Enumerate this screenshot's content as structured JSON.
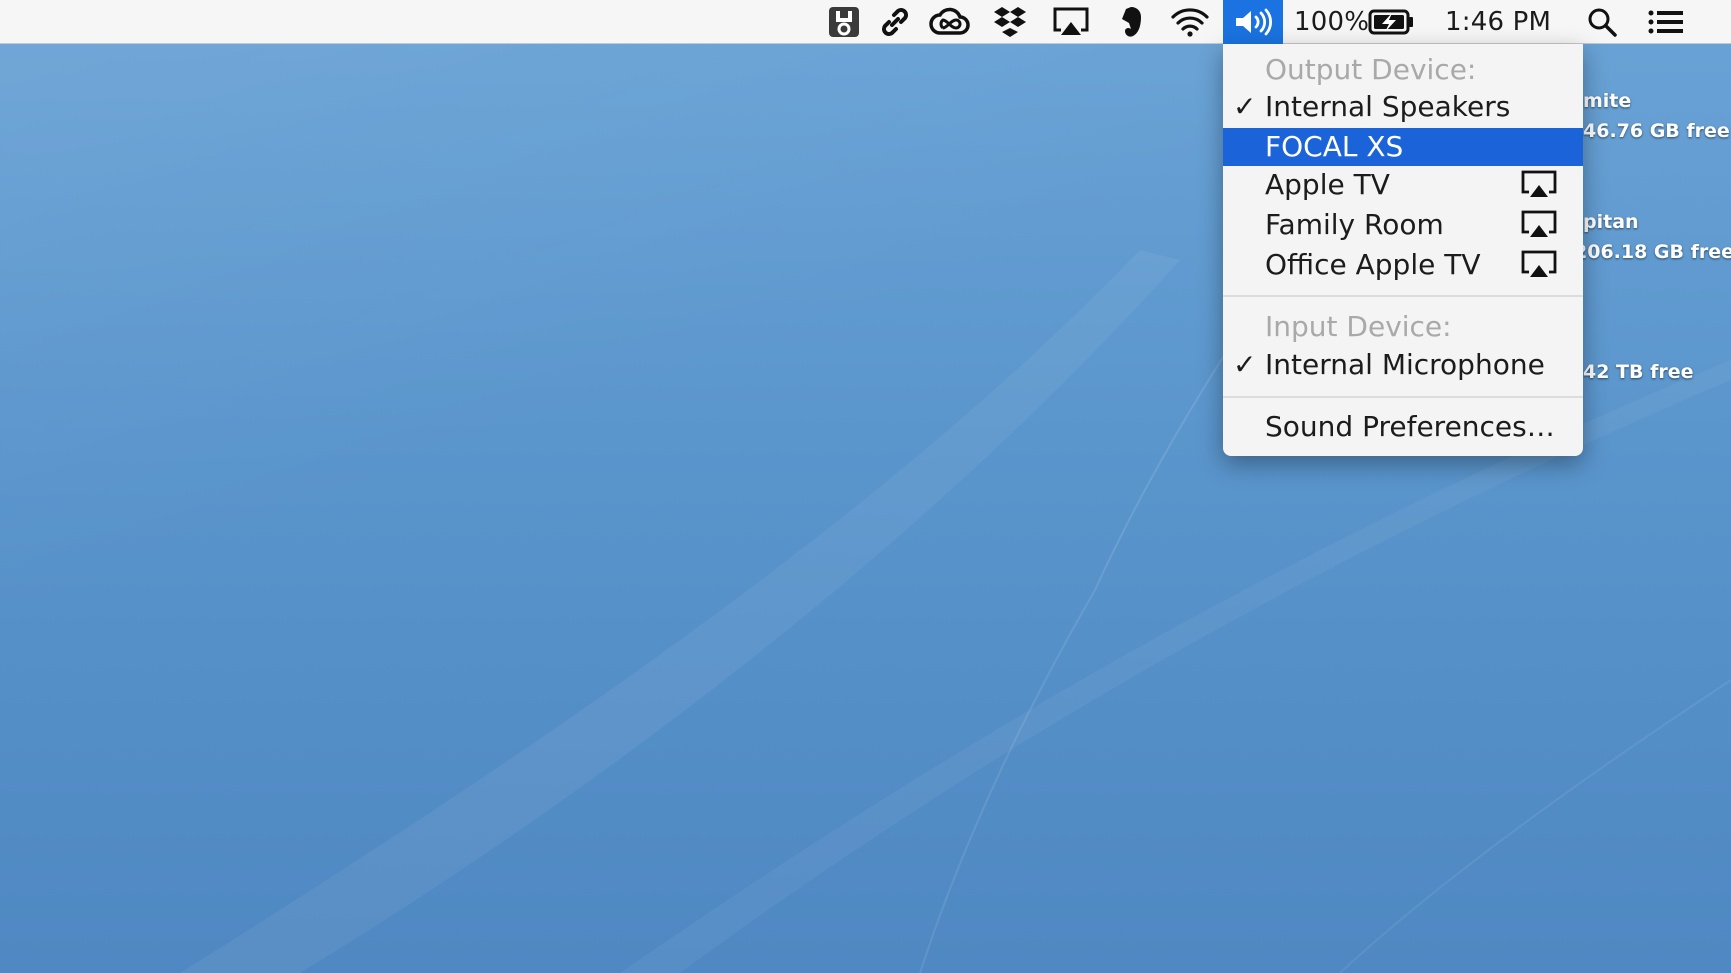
{
  "menubar": {
    "battery_percent": "100%",
    "clock": "1:46 PM",
    "icons": [
      "hammer-app-icon",
      "link-icon",
      "creative-cloud-icon",
      "dropbox-icon",
      "airplay-icon",
      "evernote-icon",
      "wifi-icon",
      "volume-icon",
      "battery-charging-icon",
      "spotlight-search-icon",
      "notification-center-icon"
    ]
  },
  "desktop": {
    "drives": [
      {
        "name_fragment": "mite",
        "free": "46.76 GB free"
      },
      {
        "name_fragment": "pitan",
        "free": "206.18 GB free"
      },
      {
        "free": "42 TB free"
      }
    ]
  },
  "sound_menu": {
    "output_header": "Output Device:",
    "outputs": [
      {
        "label": "Internal Speakers",
        "checked": true,
        "airplay": false
      },
      {
        "label": "FOCAL XS",
        "checked": false,
        "highlighted": true,
        "airplay": false
      },
      {
        "label": "Apple TV",
        "checked": false,
        "airplay": true
      },
      {
        "label": "Family Room",
        "checked": false,
        "airplay": true
      },
      {
        "label": "Office Apple TV",
        "checked": false,
        "airplay": true
      }
    ],
    "input_header": "Input Device:",
    "inputs": [
      {
        "label": "Internal Microphone",
        "checked": true
      }
    ],
    "preferences": "Sound Preferences…",
    "check_glyph": "✓"
  },
  "colors": {
    "menubar_bg": "#f6f6f6",
    "highlight": "#1b63d8",
    "desktop": "#5a95cc"
  }
}
